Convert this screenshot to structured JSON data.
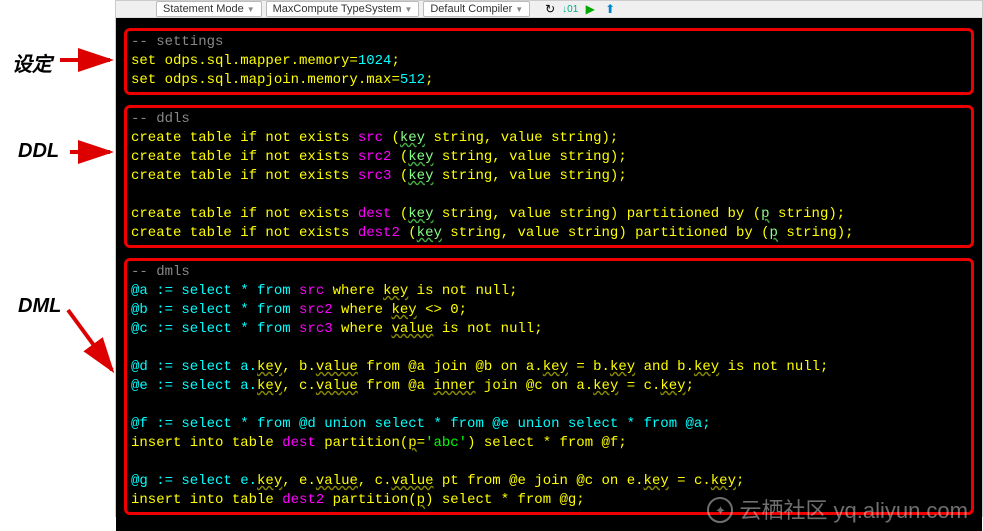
{
  "labels": {
    "settings": "设定",
    "ddl": "DDL",
    "dml": "DML"
  },
  "toolbar": {
    "statement_mode": "Statement Mode",
    "type_system": "MaxCompute TypeSystem",
    "compiler": "Default Compiler"
  },
  "code": {
    "settings": {
      "comment": "-- settings",
      "line1_pre": "set odps.sql.mapper.memory=",
      "line1_val": "1024",
      "line2_pre": "set odps.sql.mapjoin.memory.max=",
      "line2_val": "512"
    },
    "ddl": {
      "comment": "-- ddls",
      "l1a": "create table if not exists ",
      "l1t": "src",
      "l1b": " (",
      "l1c": "key",
      "l1d": " string, value string);",
      "l2t": "src2",
      "l3t": "src3",
      "l4t": "dest",
      "l4e": " string, value string) partitioned by (",
      "l4p": "p",
      "l4f": " string);",
      "l5t": "dest2"
    },
    "dml": {
      "comment": "-- dmls",
      "a_pre": "@a := select * from ",
      "a_tbl": "src",
      "a_mid": " where ",
      "a_col": "key",
      "a_end": " is not null;",
      "b_pre": "@b := select * from ",
      "b_tbl": "src2",
      "b_mid": " where ",
      "b_col": "key",
      "b_end": " <> 0;",
      "c_pre": "@c := select * from ",
      "c_tbl": "src3",
      "c_mid": " where ",
      "c_col": "value",
      "c_end": " is not null;",
      "d_pre": "@d := select a.",
      "d_k1": "key",
      "d_m1": ", b.",
      "d_k2": "value",
      "d_m2": " from @a join @b on a.",
      "d_k3": "key",
      "d_m3": " = b.",
      "d_k4": "key",
      "d_m4": " and b.",
      "d_k5": "key",
      "d_end": " is not null;",
      "e_pre": "@e := select a.",
      "e_k1": "key",
      "e_m1": ", c.",
      "e_k2": "value",
      "e_m2": " from @a ",
      "e_inner": "inner",
      "e_m3": " join @c on a.",
      "e_k3": "key",
      "e_m4": " = c.",
      "e_k4": "key",
      "e_end": ";",
      "f_line": "@f := select * from @d union select * from @e union select * from @a;",
      "ins1_a": "insert into table ",
      "ins1_t": "dest",
      "ins1_b": " partition(",
      "ins1_p": "p",
      "ins1_c": "=",
      "ins1_s": "'abc'",
      "ins1_d": ") select * from @f;",
      "g_pre": "@g := select e.",
      "g_k1": "key",
      "g_m1": ", e.",
      "g_k2": "value",
      "g_m2": ", c.",
      "g_k3": "value",
      "g_m3": " pt from @e join @c on e.",
      "g_k4": "key",
      "g_m4": " = c.",
      "g_k5": "key",
      "g_end": ";",
      "ins2_a": "insert into table ",
      "ins2_t": "dest2",
      "ins2_b": " partition(",
      "ins2_p": "p",
      "ins2_c": ") select * from @g;"
    }
  },
  "watermark": {
    "brand": "云栖社区",
    "url": "yq.aliyun.com"
  }
}
